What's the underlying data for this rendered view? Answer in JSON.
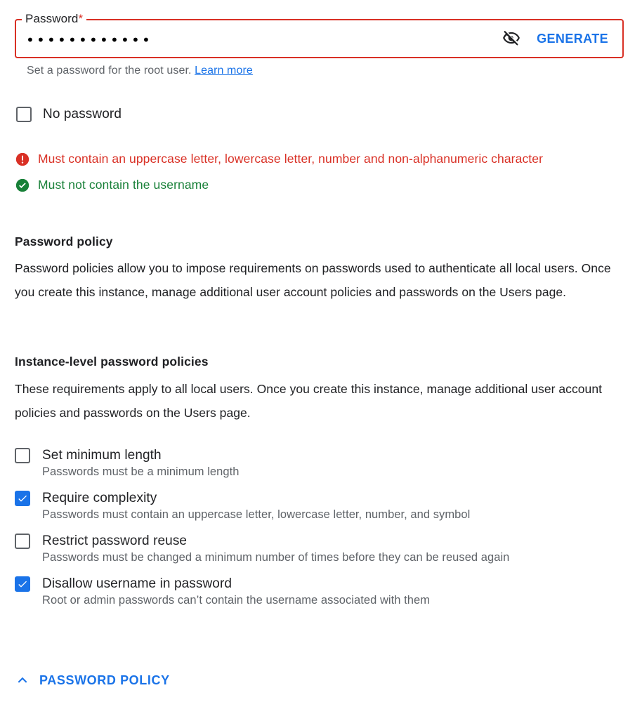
{
  "password_field": {
    "label": "Password",
    "required_marker": "*",
    "value_masked": "••••••••••••",
    "placeholder": "",
    "visibility_icon": "visibility-off-icon",
    "generate_label": "GENERATE",
    "border_color": "#d93025",
    "link_color": "#1a73e8"
  },
  "helper": {
    "text": "Set a password for the root user.",
    "link_label": "Learn more"
  },
  "no_password": {
    "label": "No password",
    "checked": false
  },
  "validation": [
    {
      "icon": "error-icon",
      "status": "error",
      "color": "#d93025",
      "text": "Must contain an uppercase letter, lowercase letter, number and non-alphanumeric character"
    },
    {
      "icon": "check-circle-icon",
      "status": "ok",
      "color": "#188038",
      "text": "Must not contain the username"
    }
  ],
  "password_policy_section": {
    "title": "Password policy",
    "body": "Password policies allow you to impose requirements on passwords used to authenticate all local users. Once you create this instance, manage additional user account policies and passwords on the Users page."
  },
  "instance_policy_section": {
    "title": "Instance-level password policies",
    "body": "These requirements apply to all local users. Once you create this instance, manage additional user account policies and passwords on the Users page."
  },
  "policy_options": [
    {
      "label": "Set minimum length",
      "description": "Passwords must be a minimum length",
      "checked": false
    },
    {
      "label": "Require complexity",
      "description": "Passwords must contain an uppercase letter, lowercase letter, number, and symbol",
      "checked": true
    },
    {
      "label": "Restrict password reuse",
      "description": "Passwords must be changed a minimum number of times before they can be reused again",
      "checked": false
    },
    {
      "label": "Disallow username in password",
      "description": "Root or admin passwords can’t contain the username associated with them",
      "checked": true
    }
  ],
  "expander": {
    "icon": "chevron-up-icon",
    "label": "PASSWORD POLICY",
    "color": "#1a73e8"
  }
}
